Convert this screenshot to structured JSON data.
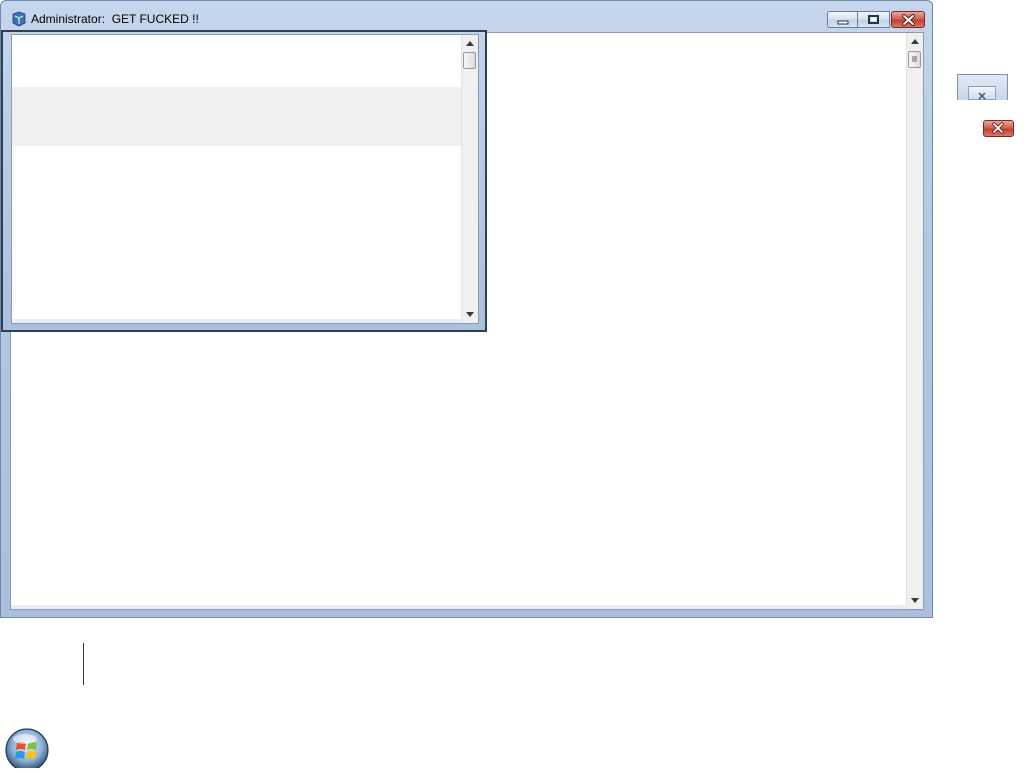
{
  "window": {
    "title": "Administrator:  GET FUCKED !!",
    "controls": {
      "minimize": "minimize",
      "maximize": "restore",
      "close": "close"
    }
  },
  "icons": {
    "app": "console-app-icon",
    "start": "windows-start-orb-icon"
  },
  "colors": {
    "frame": "#b5c9e3",
    "close_button": "#c2402f",
    "selected_row": "#f0f0f0"
  }
}
